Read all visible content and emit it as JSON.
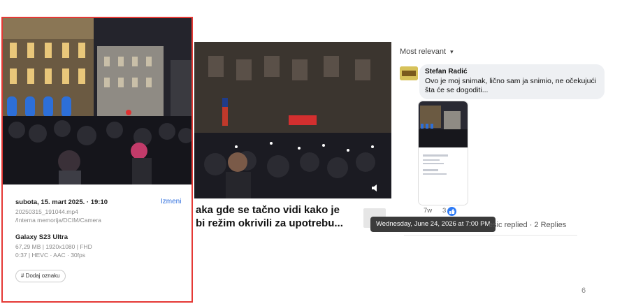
{
  "phone_info": {
    "date_time": "subota, 15. mart 2025. · 19:10",
    "edit_label": "Izmeni",
    "filename": "20250315_191044.mp4",
    "path": "/Interna memorija/DCIM/Camera",
    "device": "Galaxy S23 Ultra",
    "specs_line1": "67,29 MB   |   1920x1080   |   FHD",
    "specs_line2": "0:37   |   HEVC   ·   AAC   ·   30fps",
    "add_tag_label": "# Dodaj oznaku"
  },
  "post": {
    "caption_line1": "aka gde se tačno vidi kako je",
    "caption_line2": "bi režim okrivili za upotrebu..."
  },
  "comments": {
    "sort_label": "Most relevant",
    "author": "Stefan Radić",
    "text": "Ovo je moj snimak, lično sam ja snimio, ne očekujući šta će se dogoditi...",
    "time": "7w",
    "like_count": "3",
    "tooltip": "Wednesday, June 24, 2026 at 7:00 PM",
    "replies_text": "esic replied · 2 Replies"
  },
  "page_number": "6",
  "colors": {
    "card_border": "#e53935",
    "link_blue": "#2f6fde",
    "like_blue": "#2e7bf6",
    "tooltip_bg": "#3b3b3b"
  }
}
